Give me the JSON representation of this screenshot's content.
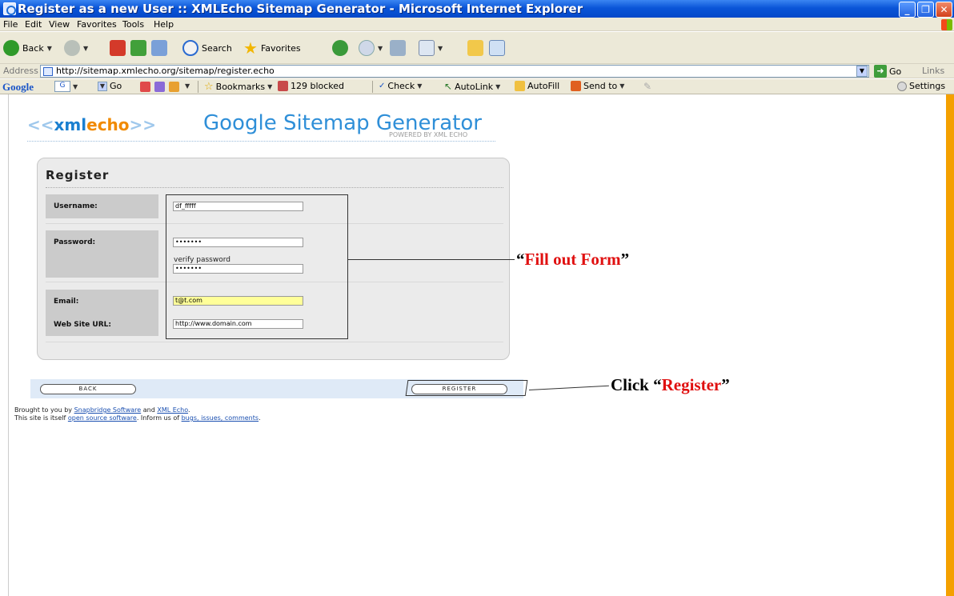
{
  "window": {
    "title": "Register as a new User :: XMLEcho Sitemap Generator - Microsoft Internet Explorer",
    "controls": [
      "_",
      "❐",
      "✕"
    ]
  },
  "menu": [
    "File",
    "Edit",
    "View",
    "Favorites",
    "Tools",
    "Help"
  ],
  "toolbar": {
    "back": "Back",
    "search": "Search",
    "favorites": "Favorites"
  },
  "address": {
    "label": "Address",
    "url": "http://sitemap.xmlecho.org/sitemap/register.echo",
    "go": "Go",
    "links": "Links"
  },
  "google_toolbar": {
    "logo": "Google",
    "go": "Go",
    "bookmarks": "Bookmarks",
    "blocked": "129 blocked",
    "check": "Check",
    "autolink": "AutoLink",
    "autofill": "AutoFill",
    "sendto": "Send to",
    "settings": "Settings"
  },
  "site": {
    "logo_left": "<<",
    "logo_xml": "xml",
    "logo_echo": "echo",
    "logo_right": ">>",
    "heading": "Google Sitemap Generator",
    "powered": "POWERED BY XML ECHO"
  },
  "form": {
    "title": "Register",
    "username_label": "Username:",
    "username_value": "df_fffff",
    "password_label": "Password:",
    "password_value": "•••••••",
    "verify_label": "verify password",
    "verify_value": "•••••••",
    "email_label": "Email:",
    "email_value": "t@t.com",
    "url_label": "Web Site URL:",
    "url_value": "http://www.domain.com"
  },
  "buttons": {
    "back": "BACK",
    "register": "REGISTER"
  },
  "footer": {
    "line1_prefix": "Brought to you by",
    "snapbridge": "Snapbridge Software",
    "and": "and",
    "xmlecho": "XML Echo",
    "line1_suffix": ".",
    "line2_prefix": "This site is itself",
    "open_source": "open source software",
    "line2_mid": ". Inform us of",
    "bugs": "bugs, issues, comments",
    "line2_suffix": "."
  },
  "annotations": {
    "fill_open": "“",
    "fill_text": "Fill out Form",
    "fill_close": "”",
    "click_prefix": "Click “",
    "click_word": "Register",
    "click_close": "”"
  }
}
